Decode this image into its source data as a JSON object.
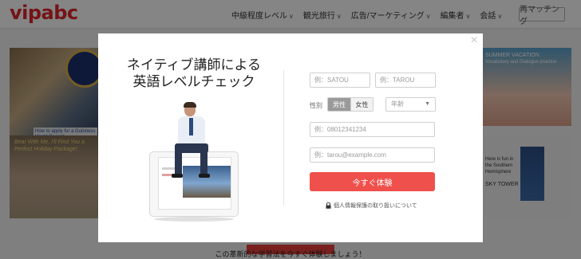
{
  "brand": {
    "logo_text": "vipabc",
    "accent": "#e0262d"
  },
  "nav": {
    "items": [
      {
        "label": "中級程度レベル"
      },
      {
        "label": "観光旅行"
      },
      {
        "label": "広告/マーケティング"
      },
      {
        "label": "編集者"
      },
      {
        "label": "会話"
      }
    ],
    "chevron_icon": "chevron-down-icon",
    "retry_button": "再マッチング"
  },
  "background": {
    "thumb1_caption": "How to apply for a Guinness World Record",
    "thumb2_text": "Bear With Me, I'll Find You a Perfect Holiday Package!",
    "thumb3_title": "SUMMER VACATION",
    "thumb3_sub": "Vocabulary and Dialogue practice",
    "thumb4_text": "Here is fun in the Southern Hemisphere",
    "thumb4_label": "SKY TOWER",
    "bottom_text": "この革新的な学習法を今すぐ体験しましょう！"
  },
  "modal": {
    "close_icon": "close-icon",
    "headline_line1": "ネイティブ講師による",
    "headline_line2": "英語レベルチェック",
    "form": {
      "last_name_placeholder": "例：SATOU",
      "first_name_placeholder": "例：TAROU",
      "gender_label": "性別",
      "gender_male": "男性",
      "gender_female": "女性",
      "gender_selected": "男性",
      "age_placeholder": "年齢",
      "phone_placeholder": "例：08012341234",
      "email_placeholder": "例：tarou@example.com",
      "submit_label": "今すぐ体験",
      "submit_color": "#f0504b",
      "privacy_text": "個人情報保護の取り扱いについて",
      "privacy_icon": "lock-icon"
    }
  }
}
